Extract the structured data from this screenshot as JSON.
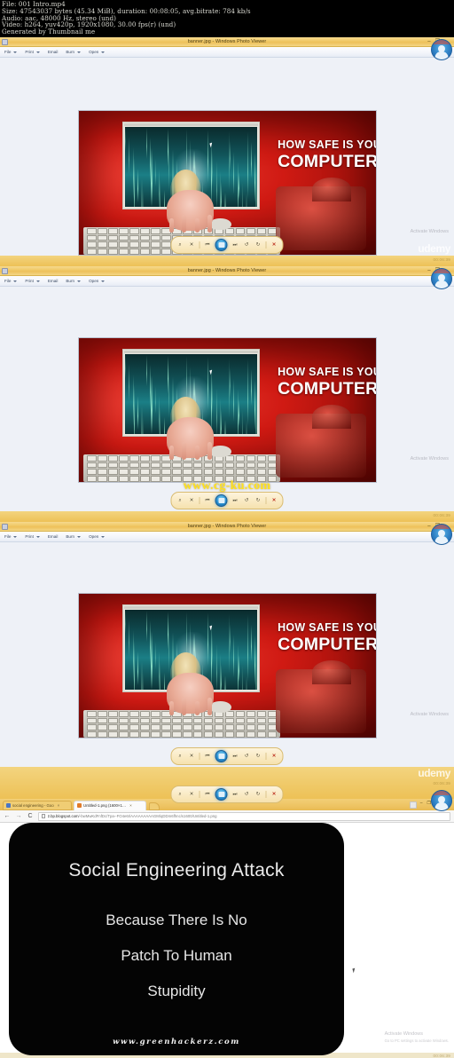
{
  "media_info": {
    "lines": [
      "File: 001 Intro.mp4",
      "Size: 47543037 bytes (45.34 MiB), duration: 00:08:05, avg.bitrate: 784 kb/s",
      "Audio: aac, 48000 Hz, stereo (und)",
      "Video: h264, yuv420p, 1920x1080, 30.00 fps(r) (und)",
      "Generated by Thumbnail me"
    ]
  },
  "photo_viewer": {
    "title": "banner.jpg - Windows Photo Viewer",
    "menu": [
      {
        "label": "File",
        "has_caret": true
      },
      {
        "label": "Print",
        "has_caret": true
      },
      {
        "label": "Email",
        "has_caret": false
      },
      {
        "label": "Burn",
        "has_caret": true
      },
      {
        "label": "Open",
        "has_caret": true
      }
    ],
    "window_buttons": [
      "–",
      "❐",
      "×"
    ],
    "toolbar": [
      {
        "name": "zoom-icon",
        "glyph": "⌕"
      },
      {
        "name": "fit-to-window-icon",
        "glyph": "✕"
      },
      {
        "name": "previous-icon",
        "glyph": "⏮"
      },
      {
        "name": "play-slideshow-icon",
        "glyph": "■"
      },
      {
        "name": "next-icon",
        "glyph": "⏭"
      },
      {
        "name": "rotate-ccw-icon",
        "glyph": "↺"
      },
      {
        "name": "rotate-cw-icon",
        "glyph": "↻"
      },
      {
        "name": "delete-icon",
        "glyph": "✕"
      }
    ]
  },
  "banner": {
    "headline_line1": "HOW SAFE IS YOUR",
    "headline_line2": "COMPUTER?"
  },
  "watermarks": {
    "activate_title": "Activate Windows",
    "activate_sub": "Go to PC settings to activate Windows.",
    "udemy": "udemy",
    "timestamp": "00:06:39",
    "cgku": "www.cg-ku.com",
    "greenhackerz": "www.greenhackerz.com"
  },
  "browser": {
    "tabs": [
      {
        "title": "social engineering - Goo",
        "active": false,
        "favicon_color": "#4a76c4",
        "close": "×"
      },
      {
        "title": "Untitled-1.png (1600×1…",
        "active": true,
        "favicon_color": "#e07b2a",
        "close": "×"
      }
    ],
    "nav": {
      "back": "←",
      "forward": "→",
      "reload": "C"
    },
    "url_domain": "2.bp.blogspot.com",
    "url_path": "/-bwMwKdFnfDc/Tpa--FO4e6I/AAAAAAAAAGM/qDDm6fhnc/s1600/Untitled-1.png",
    "window_buttons": [
      "–",
      "❐",
      "×"
    ]
  },
  "popup_image": {
    "title": "Social  Engineering  Attack",
    "line2": "Because There Is No",
    "line3": "Patch To Human",
    "line4": "Stupidity",
    "watermark": "www.greenhackerz.com"
  },
  "colors": {
    "banner_red": "#d01a13",
    "chrome_gold": "#eec463",
    "accent_blue": "#2a8fd0",
    "watermark_yellow": "#ffe11f"
  }
}
